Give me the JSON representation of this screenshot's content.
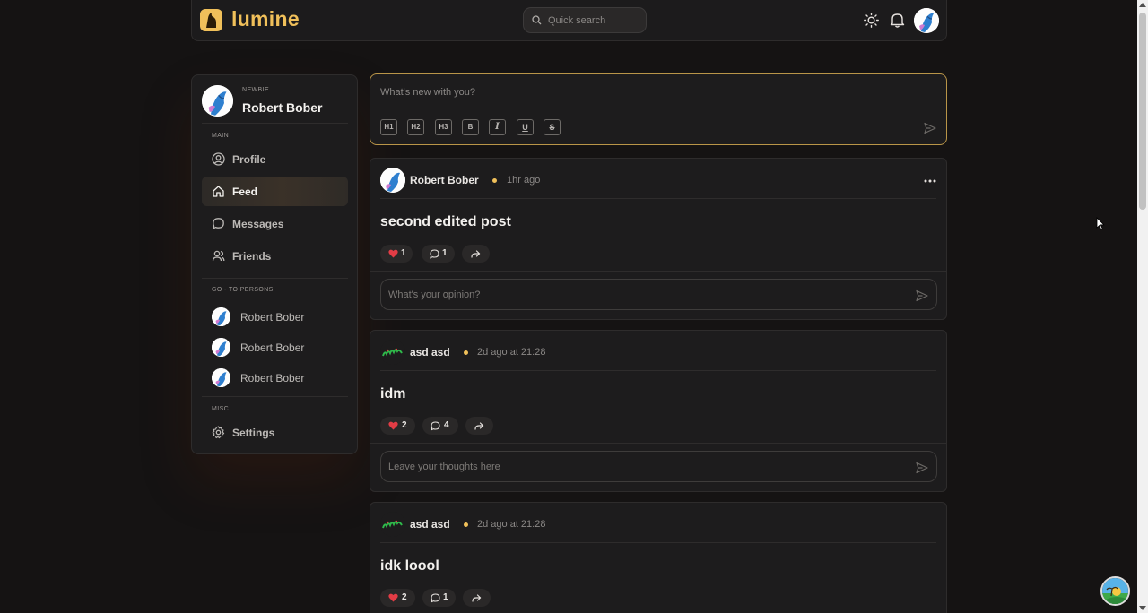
{
  "app": {
    "name": "lumine",
    "accent": "#f0c05a"
  },
  "search": {
    "placeholder": "Quick search"
  },
  "header": {
    "icons": [
      "sun-icon",
      "bell-icon",
      "avatar"
    ]
  },
  "user": {
    "rank": "NEWBIE",
    "name": "Robert Bober"
  },
  "sidebar": {
    "main_label": "MAIN",
    "items": [
      {
        "label": "Profile",
        "icon": "user-circle-icon"
      },
      {
        "label": "Feed",
        "icon": "home-icon",
        "active": true
      },
      {
        "label": "Messages",
        "icon": "chat-bubble-icon"
      },
      {
        "label": "Friends",
        "icon": "users-icon"
      }
    ],
    "persons_label": "GO - TO PERSONS",
    "persons": [
      {
        "name": "Robert Bober"
      },
      {
        "name": "Robert Bober"
      },
      {
        "name": "Robert Bober"
      }
    ],
    "misc_label": "MISC",
    "settings_label": "Settings"
  },
  "composer": {
    "placeholder": "What's new with you?",
    "tools": [
      "H1",
      "H2",
      "H3",
      "B",
      "I",
      "U",
      "S"
    ]
  },
  "posts": [
    {
      "author": "Robert Bober",
      "time": "1hr ago",
      "title": "second edited post",
      "likes": "1",
      "comments": "1",
      "reply_placeholder": "What's your opinion?"
    },
    {
      "author": "asd asd",
      "time": "2d ago at 21:28",
      "title": "idm",
      "likes": "2",
      "comments": "4",
      "reply_placeholder": "Leave your thoughts here"
    },
    {
      "author": "asd asd",
      "time": "2d ago at 21:28",
      "title": "idk loool",
      "likes": "2",
      "comments": "1"
    }
  ]
}
